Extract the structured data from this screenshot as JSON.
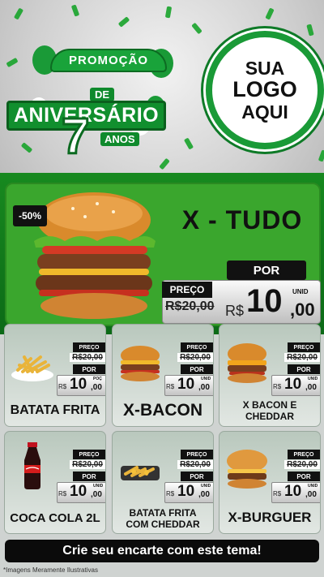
{
  "header": {
    "promo_word": "PROMOÇÃO",
    "de": "DE",
    "aniversario": "ANIVERSÁRIO",
    "number": "7",
    "anos": "ANOS",
    "logo_lines": [
      "SUA",
      "LOGO",
      "AQUI"
    ]
  },
  "hero": {
    "discount": "-50%",
    "name": "X - TUDO",
    "preco_label": "PREÇO",
    "old_price": "R$20,00",
    "por_label": "POR",
    "currency": "R$",
    "price_int": "10",
    "price_dec": ",00",
    "unit": "UNID"
  },
  "cards": [
    {
      "name": "BATATA FRITA",
      "preco_label": "PREÇO",
      "old": "R$20,00",
      "por_label": "POR",
      "currency": "R$",
      "int": "10",
      "dec": ",00",
      "unit": "POÇ",
      "icon": "fries-icon"
    },
    {
      "name": "X-BACON",
      "preco_label": "PREÇO",
      "old": "R$20,00",
      "por_label": "POR",
      "currency": "R$",
      "int": "10",
      "dec": ",00",
      "unit": "UNID",
      "icon": "burger-icon"
    },
    {
      "name": "X BACON E CHEDDAR",
      "preco_label": "PREÇO",
      "old": "R$20,00",
      "por_label": "POR",
      "currency": "R$",
      "int": "10",
      "dec": ",00",
      "unit": "UNID",
      "icon": "burger-icon"
    },
    {
      "name": "COCA COLA 2L",
      "preco_label": "PREÇO",
      "old": "R$20,00",
      "por_label": "POR",
      "currency": "R$",
      "int": "10",
      "dec": ",00",
      "unit": "UNID",
      "icon": "soda-bottle-icon"
    },
    {
      "name": "BATATA FRITA COM CHEDDAR",
      "preco_label": "PREÇO",
      "old": "R$20,00",
      "por_label": "POR",
      "currency": "R$",
      "int": "10",
      "dec": ",00",
      "unit": "UNID",
      "icon": "fries-icon"
    },
    {
      "name": "X-BURGUER",
      "preco_label": "PREÇO",
      "old": "R$20,00",
      "por_label": "POR",
      "currency": "R$",
      "int": "10",
      "dec": ",00",
      "unit": "UNID",
      "icon": "burger-icon"
    }
  ],
  "cta": "Crie seu encarte com este tema!",
  "disclaimer": "*Imagens Meramente Ilustrativas",
  "colors": {
    "brand_green": "#17891f",
    "accent_black": "#111111"
  }
}
